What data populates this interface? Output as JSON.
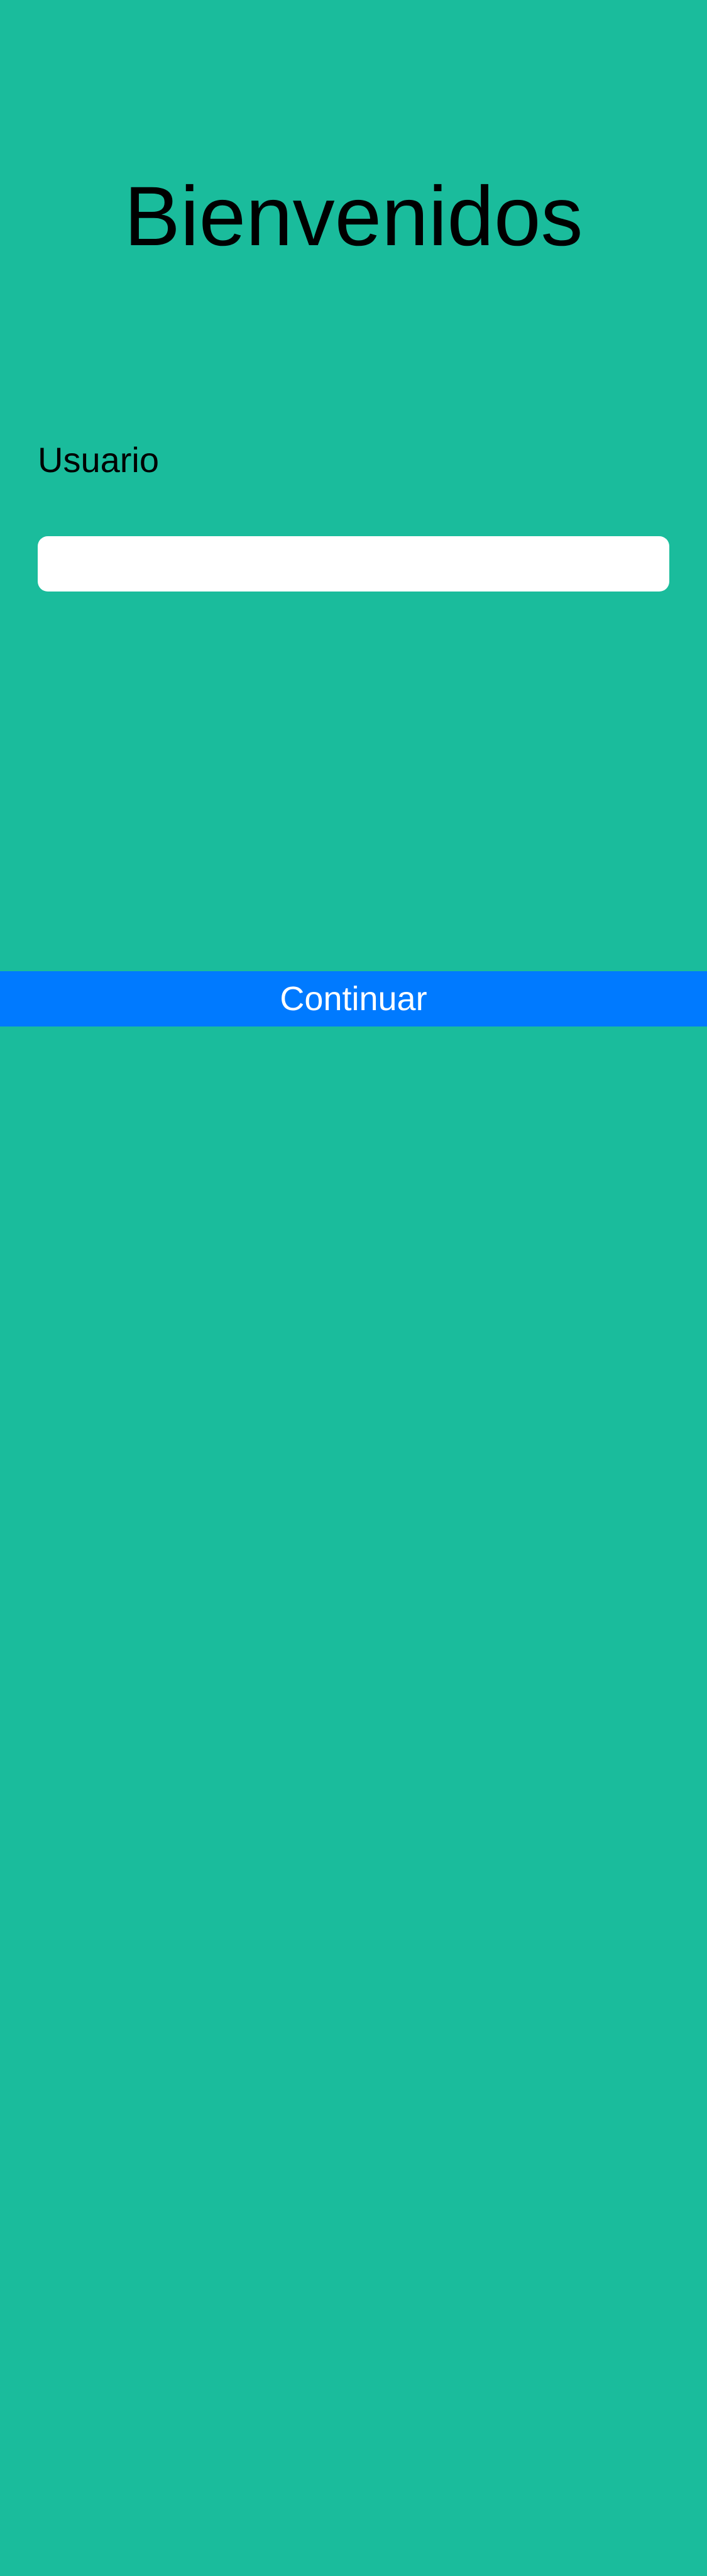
{
  "welcome": {
    "title": "Bienvenidos"
  },
  "form": {
    "username_label": "Usuario",
    "username_value": "",
    "username_placeholder": ""
  },
  "actions": {
    "continue_label": "Continuar"
  },
  "colors": {
    "background": "#1abc9c",
    "button": "#007aff",
    "button_text": "#ffffff",
    "input_background": "#ffffff",
    "text": "#000000"
  }
}
